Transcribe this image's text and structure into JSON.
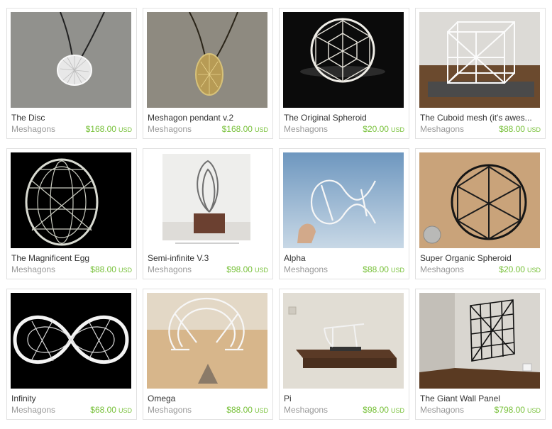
{
  "listings": [
    {
      "title": "The Disc",
      "shop": "Meshagons",
      "price": "$168.00",
      "currency": "USD",
      "image": "disc-pendant-photo"
    },
    {
      "title": "Meshagon pendant v.2",
      "shop": "Meshagons",
      "price": "$168.00",
      "currency": "USD",
      "image": "gold-pendant-photo"
    },
    {
      "title": "The Original Spheroid",
      "shop": "Meshagons",
      "price": "$20.00",
      "currency": "USD",
      "image": "spheroid-photo"
    },
    {
      "title": "The Cuboid mesh (it's awes...",
      "shop": "Meshagons",
      "price": "$88.00",
      "currency": "USD",
      "image": "cuboid-photo"
    },
    {
      "title": "The Magnificent Egg",
      "shop": "Meshagons",
      "price": "$88.00",
      "currency": "USD",
      "image": "egg-photo"
    },
    {
      "title": "Semi-infinite V.3",
      "shop": "Meshagons",
      "price": "$98.00",
      "currency": "USD",
      "image": "semi-infinite-photo"
    },
    {
      "title": "Alpha",
      "shop": "Meshagons",
      "price": "$88.00",
      "currency": "USD",
      "image": "alpha-photo"
    },
    {
      "title": "Super Organic Spheroid",
      "shop": "Meshagons",
      "price": "$20.00",
      "currency": "USD",
      "image": "black-spheroid-photo"
    },
    {
      "title": "Infinity",
      "shop": "Meshagons",
      "price": "$68.00",
      "currency": "USD",
      "image": "infinity-photo"
    },
    {
      "title": "Omega",
      "shop": "Meshagons",
      "price": "$88.00",
      "currency": "USD",
      "image": "omega-photo"
    },
    {
      "title": "Pi",
      "shop": "Meshagons",
      "price": "$98.00",
      "currency": "USD",
      "image": "pi-photo"
    },
    {
      "title": "The Giant Wall Panel",
      "shop": "Meshagons",
      "price": "$798.00",
      "currency": "USD",
      "image": "wall-panel-photo"
    }
  ],
  "colors": {
    "price": "#78c13a",
    "shop": "#999999",
    "title": "#333333",
    "border": "#e1e1e1"
  }
}
